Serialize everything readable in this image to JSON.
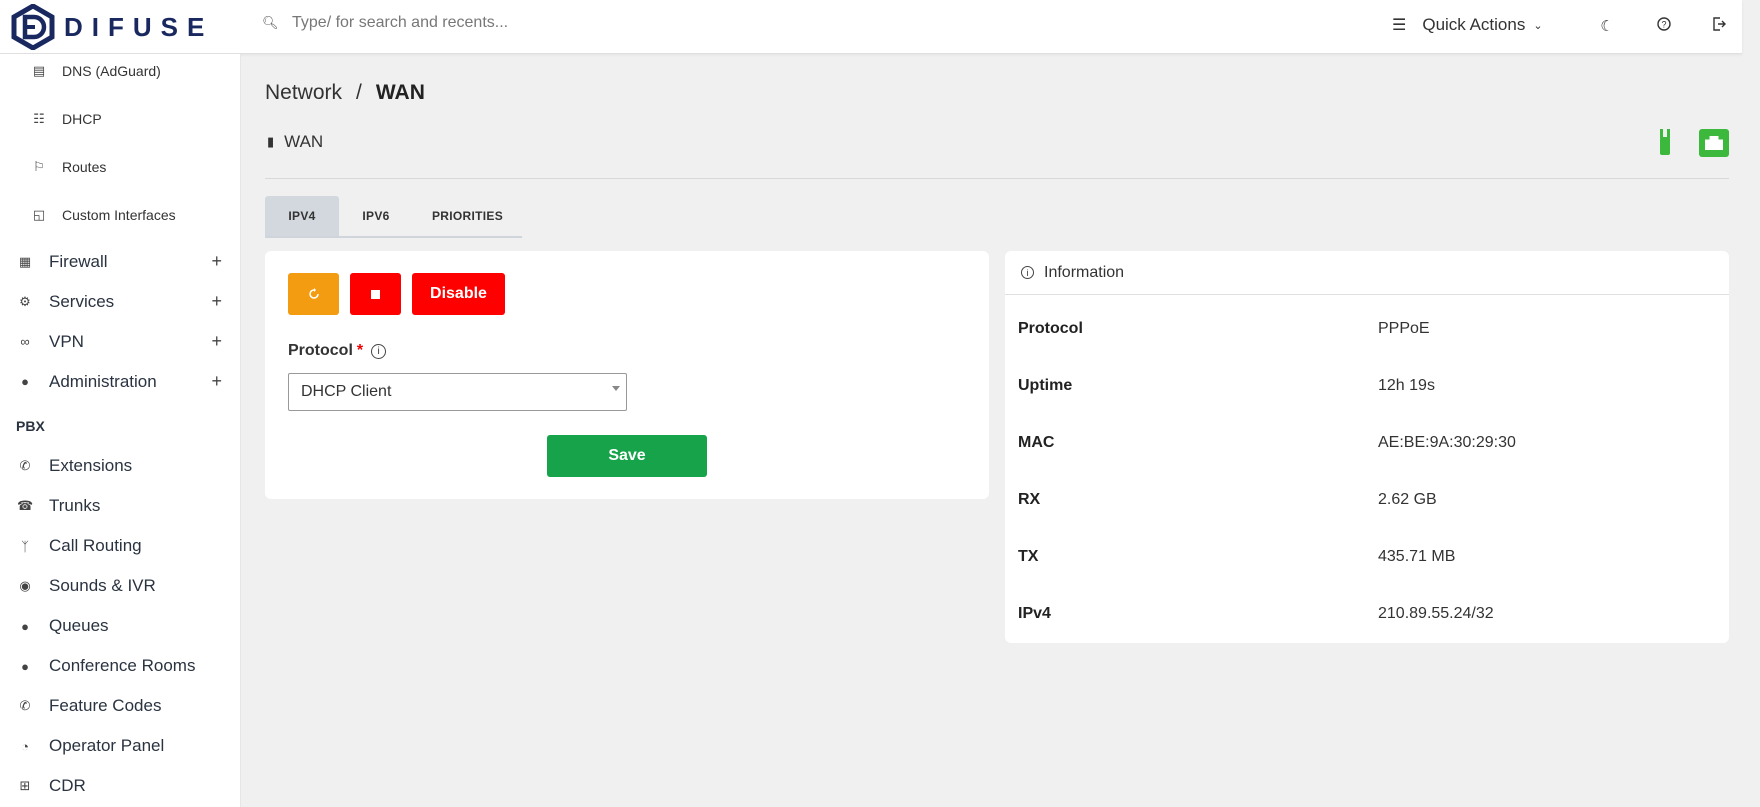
{
  "brand": {
    "name": "DIFUSE"
  },
  "topbar": {
    "search_placeholder": "Type/ for search and recents...",
    "quick_actions_label": "Quick Actions"
  },
  "sidebar": {
    "sub_items": [
      {
        "label": "DNS (AdGuard)",
        "icon": "dns-server-icon"
      },
      {
        "label": "DHCP",
        "icon": "dhcp-icon"
      },
      {
        "label": "Routes",
        "icon": "signpost-icon"
      },
      {
        "label": "Custom Interfaces",
        "icon": "custom-interface-icon"
      }
    ],
    "groups": [
      {
        "label": "Firewall",
        "icon": "firewall-icon"
      },
      {
        "label": "Services",
        "icon": "services-icon"
      },
      {
        "label": "VPN",
        "icon": "vpn-icon"
      },
      {
        "label": "Administration",
        "icon": "admin-user-icon"
      }
    ],
    "pbx_heading": "PBX",
    "pbx_items": [
      {
        "label": "Extensions",
        "icon": "phone-icon"
      },
      {
        "label": "Trunks",
        "icon": "trunks-icon"
      },
      {
        "label": "Call Routing",
        "icon": "call-routing-icon"
      },
      {
        "label": "Sounds & IVR",
        "icon": "robot-icon"
      },
      {
        "label": "Queues",
        "icon": "person-icon"
      },
      {
        "label": "Conference Rooms",
        "icon": "group-icon"
      },
      {
        "label": "Feature Codes",
        "icon": "phone-forward-icon"
      },
      {
        "label": "Operator Panel",
        "icon": "camera-icon"
      },
      {
        "label": "CDR",
        "icon": "table-icon"
      }
    ]
  },
  "breadcrumb": {
    "parent": "Network",
    "separator": "/",
    "current": "WAN"
  },
  "interface": {
    "name": "WAN"
  },
  "tabs": [
    "IPV4",
    "IPV6",
    "PRIORITIES"
  ],
  "active_tab": "IPV4",
  "form": {
    "disable_label": "Disable",
    "protocol_label": "Protocol",
    "required_mark": "*",
    "protocol_value": "DHCP Client",
    "save_label": "Save"
  },
  "info": {
    "title": "Information",
    "rows": [
      {
        "key": "Protocol",
        "value": "PPPoE"
      },
      {
        "key": "Uptime",
        "value": "12h 19s"
      },
      {
        "key": "MAC",
        "value": "AE:BE:9A:30:29:30"
      },
      {
        "key": "RX",
        "value": "2.62 GB"
      },
      {
        "key": "TX",
        "value": "435.71 MB"
      },
      {
        "key": "IPv4",
        "value": "210.89.55.24/32"
      }
    ]
  },
  "colors": {
    "restart": "#f39c12",
    "stop": "#ff0000",
    "disable": "#ff0000",
    "save": "#16a34a",
    "status_ok": "#3cb83c",
    "brand": "#1a2860"
  }
}
